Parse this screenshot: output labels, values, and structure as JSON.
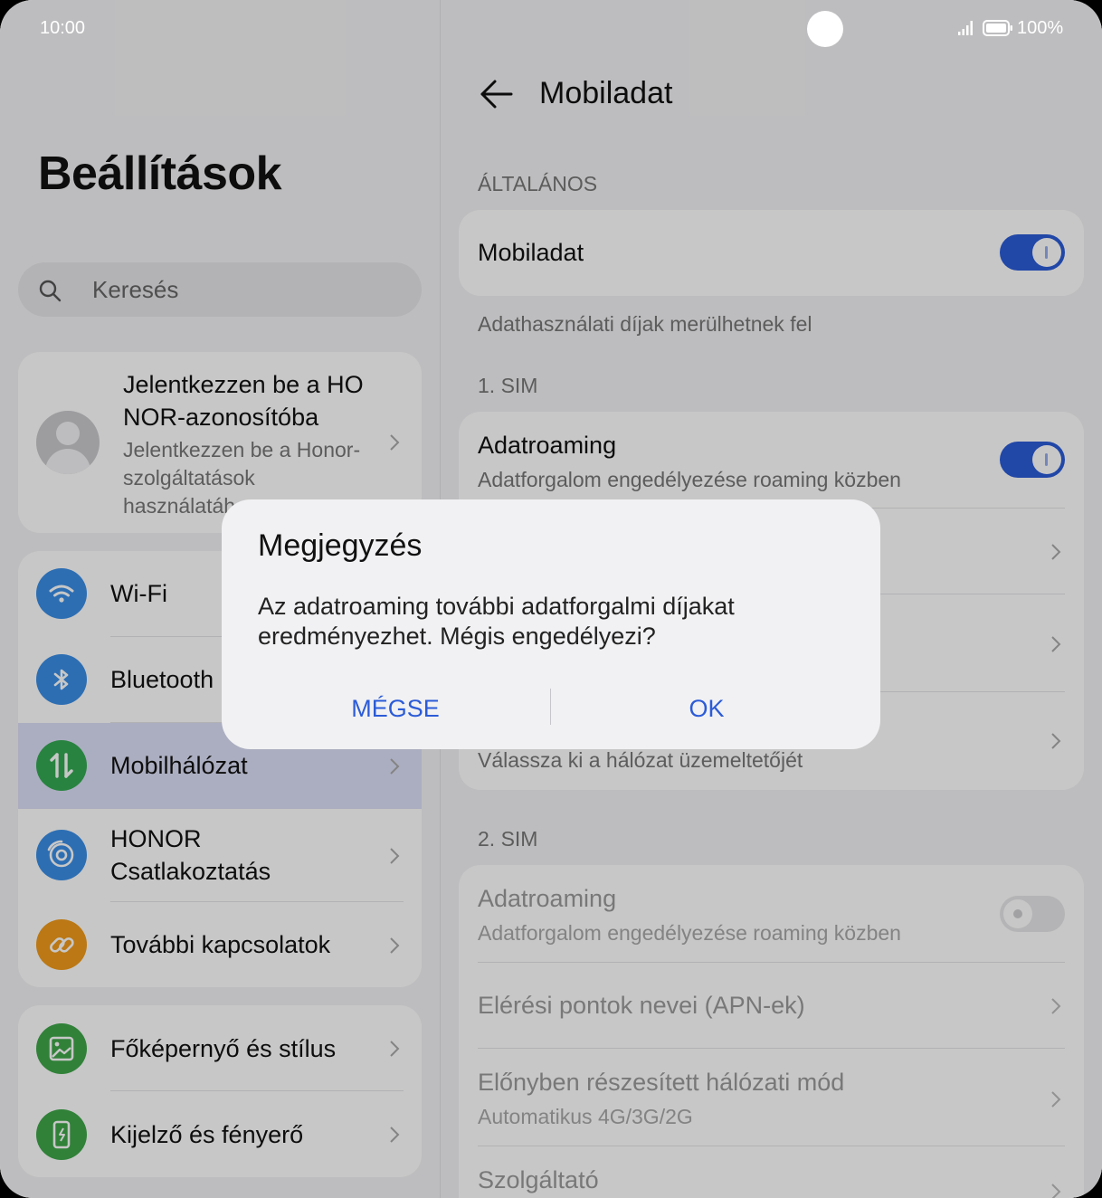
{
  "status_bar": {
    "time": "10:00",
    "battery": "100%"
  },
  "left_panel": {
    "title": "Beállítások",
    "search_placeholder": "Keresés",
    "account": {
      "name": "Jelentkezzen be a HONOR-azonosítóba",
      "subtitle": "Jelentkezzen be a Honor-szolgáltatások használatához"
    },
    "items": [
      {
        "label": "Wi-Fi",
        "icon": "wifi-icon",
        "color": "#3a8ee6"
      },
      {
        "label": "Bluetooth",
        "icon": "bluetooth-icon",
        "color": "#3a8ee6"
      },
      {
        "label": "Mobilhálózat",
        "icon": "mobile-data-icon",
        "color": "#34a853"
      },
      {
        "label": "HONOR Csatlakoztatás",
        "icon": "honor-connect-icon",
        "color": "#3a8ee6"
      },
      {
        "label": "További kapcsolatok",
        "icon": "link-icon",
        "color": "#f09a1a"
      },
      {
        "label": "Főképernyő és stílus",
        "icon": "wallpaper-icon",
        "color": "#3fa64a"
      },
      {
        "label": "Kijelző és fényerő",
        "icon": "display-icon",
        "color": "#3fa64a"
      }
    ]
  },
  "right_panel": {
    "title": "Mobiladat",
    "section_general": "ÁLTALÁNOS",
    "mobile_data": {
      "label": "Mobiladat",
      "on": true
    },
    "mobile_data_note": "Adathasználati díjak merülhetnek fel",
    "sim1": {
      "header": "1. SIM",
      "roaming": {
        "title": "Adatroaming",
        "subtitle": "Adatforgalom engedélyezése roaming közben",
        "on": true
      },
      "operator_subtitle": "Válassza ki a hálózat üzemeltetőjét"
    },
    "sim2": {
      "header": "2. SIM",
      "roaming": {
        "title": "Adatroaming",
        "subtitle": "Adatforgalom engedélyezése roaming közben",
        "on": false
      },
      "apn": "Elérési pontok nevei (APN-ek)",
      "network_mode": {
        "title": "Előnyben részesített hálózati mód",
        "subtitle": "Automatikus 4G/3G/2G"
      },
      "operator": "Szolgáltató"
    }
  },
  "dialog": {
    "title": "Megjegyzés",
    "message": "Az adatroaming további adatforgalmi díjakat eredményezhet. Mégis engedélyezi?",
    "cancel": "MÉGSE",
    "ok": "OK",
    "accent": "#2b5bd7"
  }
}
